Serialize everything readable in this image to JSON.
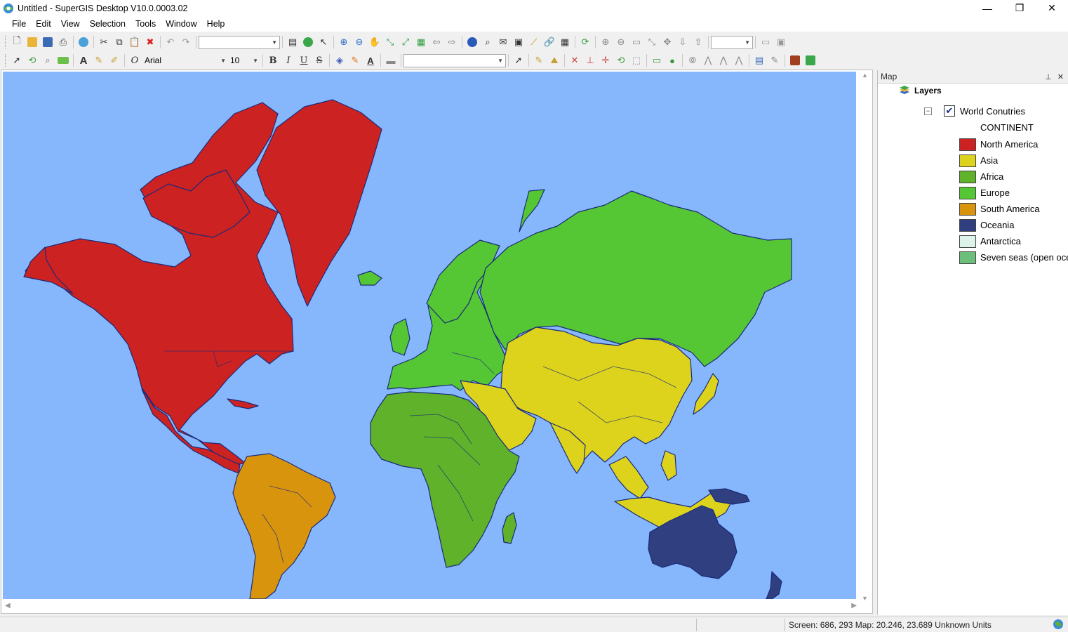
{
  "window": {
    "title": "Untitled - SuperGIS Desktop V10.0.0003.02",
    "minimize": "—",
    "restore": "❐",
    "close": "✕"
  },
  "menu": [
    "File",
    "Edit",
    "View",
    "Selection",
    "Tools",
    "Window",
    "Help"
  ],
  "toolbar2": {
    "font_name": "Arial",
    "font_size": "10",
    "bold": "B",
    "italic": "I",
    "underline": "U",
    "strike": "S"
  },
  "panel": {
    "title": "Map",
    "layers_label": "Layers",
    "layer_name": "World Conutries",
    "legend_field": "CONTINENT",
    "legend": [
      {
        "label": "North America",
        "color": "#cc2222"
      },
      {
        "label": "Asia",
        "color": "#ddd31c"
      },
      {
        "label": "Africa",
        "color": "#5fb22a"
      },
      {
        "label": "Europe",
        "color": "#56c734"
      },
      {
        "label": "South America",
        "color": "#d9940e"
      },
      {
        "label": "Oceania",
        "color": "#2f3f80"
      },
      {
        "label": "Antarctica",
        "color": "#dcf3ea"
      },
      {
        "label": "Seven seas (open ocean)",
        "color": "#6bbf7a"
      }
    ]
  },
  "map": {
    "ocean_color": "#86b7fc",
    "border_color": "#1a2a78"
  },
  "status": {
    "coords": "Screen: 686, 293  Map: 20.246, 23.689 Unknown Units"
  }
}
